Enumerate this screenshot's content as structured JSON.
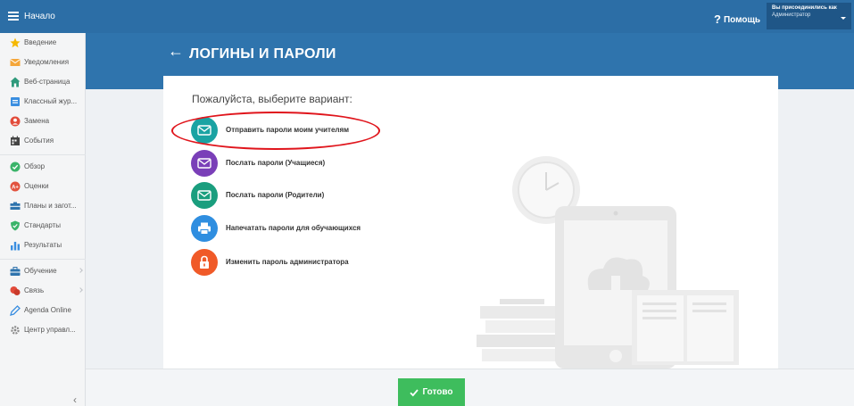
{
  "topbar": {
    "home_label": "Начало",
    "help_icon": "?",
    "help_label": "Помощь",
    "user_line1": "Вы присоединились как",
    "user_line2": "Администратор"
  },
  "sidebar": {
    "items": [
      {
        "label": "Введение",
        "icon": "star-icon",
        "color": "#f5b800"
      },
      {
        "label": "Уведомления",
        "icon": "envelope-icon",
        "color": "#f4a63a"
      },
      {
        "label": "Веб-страница",
        "icon": "home-icon",
        "color": "#2f9a7c"
      },
      {
        "label": "Классный жур...",
        "icon": "journal-icon",
        "color": "#3a8ee0"
      },
      {
        "label": "Замена",
        "icon": "person-icon",
        "color": "#e24b3a"
      },
      {
        "label": "События",
        "icon": "calendar-icon",
        "color": "#444444"
      },
      {
        "label": "Обзор",
        "icon": "check-circle-icon",
        "color": "#3bb46a"
      },
      {
        "label": "Оценки",
        "icon": "grade-icon",
        "color": "#e2533f"
      },
      {
        "label": "Планы и загот...",
        "icon": "plans-icon",
        "color": "#2f74ad"
      },
      {
        "label": "Стандарты",
        "icon": "shield-icon",
        "color": "#3bb46a"
      },
      {
        "label": "Результаты",
        "icon": "bar-chart-icon",
        "color": "#3a8ee0"
      },
      {
        "label": "Обучение",
        "icon": "briefcase-icon",
        "color": "#2f74ad"
      },
      {
        "label": "Связь",
        "icon": "chat-icon",
        "color": "#e24b3a"
      },
      {
        "label": "Agenda Online",
        "icon": "pen-icon",
        "color": "#3a8ee0"
      },
      {
        "label": "Центр управл...",
        "icon": "gear-icon",
        "color": "#8a8a8a"
      }
    ],
    "collapse_glyph": "‹"
  },
  "header": {
    "back_glyph": "←",
    "title": "ЛОГИНЫ И ПАРОЛИ"
  },
  "main": {
    "prompt": "Пожалуйста, выберите вариант:",
    "options": [
      {
        "label": "Отправить пароли моим учителям",
        "icon": "envelope-icon",
        "color": "#1aa3a3"
      },
      {
        "label": "Послать пароли (Учащиеся)",
        "icon": "envelope-icon",
        "color": "#7a3fb8"
      },
      {
        "label": "Послать пароли (Родители)",
        "icon": "envelope-icon",
        "color": "#1a9e7e"
      },
      {
        "label": "Напечатать пароли для обучающихся",
        "icon": "printer-icon",
        "color": "#2f8ee0"
      },
      {
        "label": "Изменить пароль администратора",
        "icon": "lock-icon",
        "color": "#f05a28"
      }
    ]
  },
  "footer": {
    "done_label": "Готово",
    "done_color": "#3ebd5d"
  }
}
